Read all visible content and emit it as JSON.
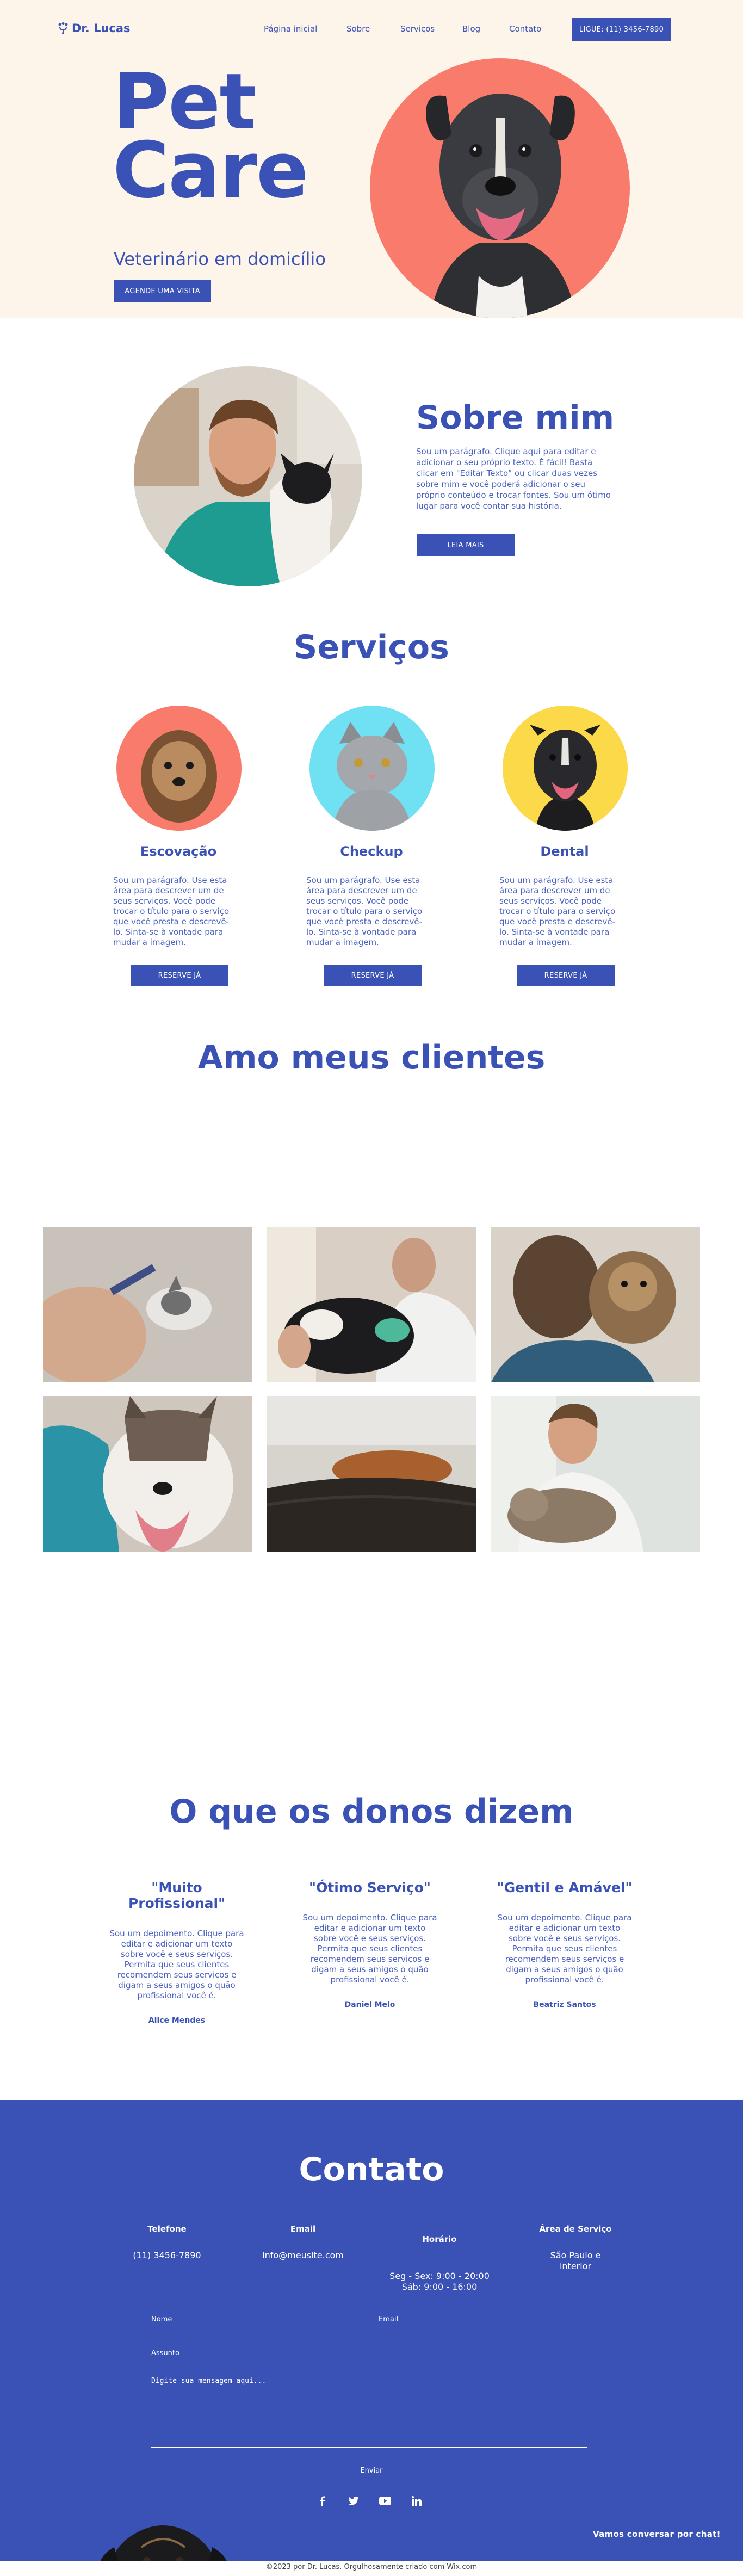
{
  "header": {
    "logo": "Dr. Lucas",
    "nav": [
      "Página inicial",
      "Sobre",
      "Serviços",
      "Blog",
      "Contato"
    ],
    "phone_button": "LIGUE: (11) 3456-7890"
  },
  "hero": {
    "title_line1": "Pet",
    "title_line2": "Care",
    "subtitle": "Veterinário em domicílio",
    "cta": "AGENDE UMA VISITA"
  },
  "about": {
    "title": "Sobre mim",
    "text": "Sou um parágrafo. Clique aqui para editar e adicionar o seu próprio texto. É fácil! Basta clicar em \"Editar Texto\" ou clicar duas vezes sobre mim e você poderá adicionar o seu próprio conteúdo e trocar fontes. Sou um ótimo lugar para você contar sua história.",
    "button": "LEIA MAIS"
  },
  "services": {
    "title": "Serviços",
    "items": [
      {
        "name": "Escovação",
        "text": "Sou um parágrafo. Use esta área para descrever um de seus serviços. Você pode trocar o título para o serviço que você presta e descrevê-lo. Sinta-se à vontade para mudar a imagem.",
        "button": "RESERVE JÁ",
        "color": "#f87b6b"
      },
      {
        "name": "Checkup",
        "text": "Sou um parágrafo. Use esta área para descrever um de seus serviços. Você pode trocar o título para o serviço que você presta e descrevê-lo. Sinta-se à vontade para mudar a imagem.",
        "button": "RESERVE JÁ",
        "color": "#6fe1f3"
      },
      {
        "name": "Dental",
        "text": "Sou um parágrafo. Use esta área para descrever um de seus serviços. Você pode trocar o título para o serviço que você presta e descrevê-lo. Sinta-se à vontade para mudar a imagem.",
        "button": "RESERVE JÁ",
        "color": "#fbd948"
      }
    ]
  },
  "clients": {
    "title": "Amo meus clientes"
  },
  "testimonials": {
    "title": "O que os donos dizem",
    "items": [
      {
        "quote": "\"Muito Profissional\"",
        "text": "Sou um depoimento. Clique para editar e adicionar um texto sobre você e seus serviços. Permita que seus clientes recomendem seus serviços e digam a seus amigos o quão profissional você é.",
        "author": "Alice Mendes"
      },
      {
        "quote": "\"Ótimo Serviço\"",
        "text": "Sou um depoimento. Clique para editar e adicionar um texto sobre você e seus serviços. Permita que seus clientes recomendem seus serviços e digam a seus amigos o quão profissional você é.",
        "author": "Daniel Melo"
      },
      {
        "quote": "\"Gentil e Amável\"",
        "text": "Sou um depoimento. Clique para editar e adicionar um texto sobre você e seus serviços. Permita que seus clientes recomendem seus serviços e digam a seus amigos o quão profissional você é.",
        "author": "Beatriz Santos"
      }
    ]
  },
  "contact": {
    "title": "Contato",
    "columns": [
      {
        "heading": "Telefone",
        "value": "(11) 3456-7890"
      },
      {
        "heading": "Email",
        "value": "info@meusite.com"
      },
      {
        "heading": "Horário",
        "value": "Seg - Sex: 9:00 - 20:00\nSáb: 9:00 - 16:00"
      },
      {
        "heading": "Área de Serviço",
        "value": "São Paulo e interior"
      }
    ],
    "form": {
      "name_label": "Nome",
      "email_label": "Email",
      "subject_label": "Assunto",
      "message_placeholder": "Digite sua mensagem aqui...",
      "send": "Enviar"
    },
    "social_icons": [
      "facebook-icon",
      "twitter-icon",
      "youtube-icon",
      "linkedin-icon"
    ],
    "chat": "Vamos conversar por chat!"
  },
  "footer": {
    "text": "©2023 por Dr. Lucas. Orgulhosamente criado com Wix.com"
  },
  "colors": {
    "brand_blue": "#3a52b5",
    "hero_bg": "#fdf4ea",
    "coral": "#f87b6b",
    "cyan": "#6fe1f3",
    "yellow": "#fbd948"
  }
}
